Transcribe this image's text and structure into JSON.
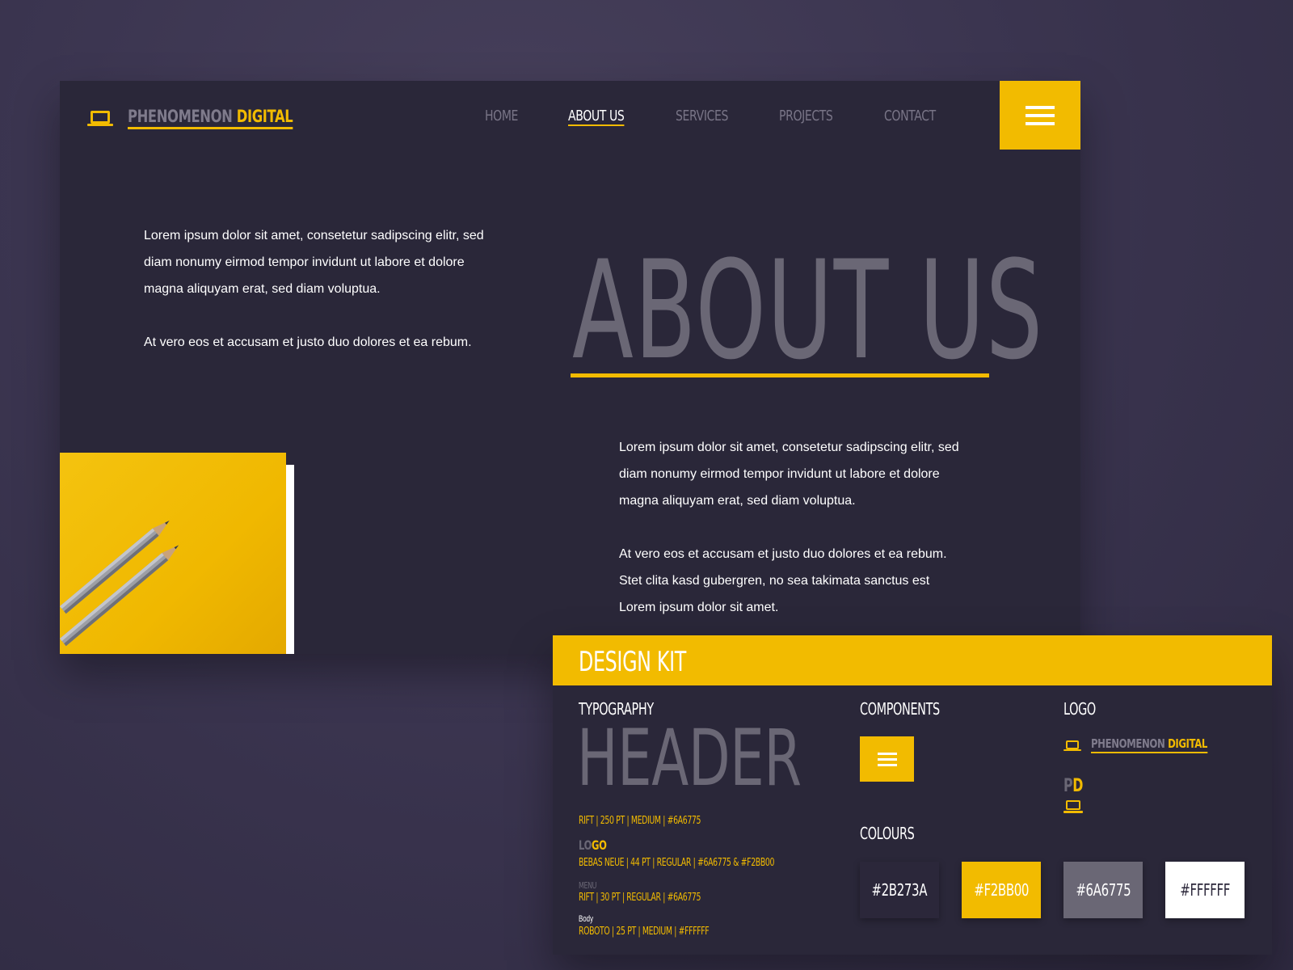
{
  "brand": {
    "part1": "PHENOMENON",
    "part2": "DIGITAL"
  },
  "nav": {
    "items": [
      {
        "label": "HOME"
      },
      {
        "label": "ABOUT US"
      },
      {
        "label": "SERVICES"
      },
      {
        "label": "PROJECTS"
      },
      {
        "label": "CONTACT"
      }
    ],
    "active": "ABOUT US"
  },
  "hero": {
    "intro_p1": "Lorem ipsum dolor sit amet, consetetur sadipscing elitr, sed diam nonumy eirmod tempor invidunt ut labore et dolore magna aliquyam erat, sed diam voluptua.",
    "intro_p2": "At vero eos et accusam et justo duo dolores et ea rebum.",
    "title": "ABOUT US",
    "body_p1": "Lorem ipsum dolor sit amet, consetetur sadipscing elitr, sed diam nonumy eirmod tempor invidunt ut labore et dolore magna aliquyam erat, sed diam voluptua.",
    "body_p2": "At vero eos et accusam et justo duo dolores et ea rebum. Stet clita kasd gubergren, no sea takimata sanctus est Lorem ipsum dolor sit amet."
  },
  "design_kit": {
    "title": "DESIGN KIT",
    "typography": {
      "label": "TYPOGRAPHY",
      "header_sample": "HEADER",
      "header_spec": "RIFT | 250 PT | MEDIUM | #6A6775",
      "logo_sample_a": "LO",
      "logo_sample_b": "GO",
      "logo_spec": "BEBAS NEUE | 44 PT | REGULAR | #6A6775 & #F2BB00",
      "menu_sample": "MENU",
      "menu_spec": "RIFT | 30 PT | REGULAR | #6A6775",
      "body_sample": "Body",
      "body_spec": "ROBOTO | 25 PT | MEDIUM | #FFFFFF"
    },
    "components": {
      "label": "COMPONENTS"
    },
    "logo": {
      "label": "LOGO",
      "mono_a": "P",
      "mono_b": "D"
    },
    "colours": {
      "label": "COLOURS",
      "swatches": [
        {
          "hex": "#2B273A",
          "text_color": "#ffffff"
        },
        {
          "hex": "#F2BB00",
          "text_color": "#ffffff"
        },
        {
          "hex": "#6A6775",
          "text_color": "#ffffff"
        },
        {
          "hex": "#FFFFFF",
          "text_color": "#2b273a"
        }
      ]
    }
  },
  "colors": {
    "background": "#3b3550",
    "panel": "#2a2739",
    "accent": "#f2bb00",
    "muted": "#6a6775",
    "white": "#ffffff"
  },
  "icons": {
    "brand": "laptop-icon",
    "menu": "hamburger-menu-icon"
  },
  "image": {
    "subject": "pencils-on-yellow-photo"
  }
}
